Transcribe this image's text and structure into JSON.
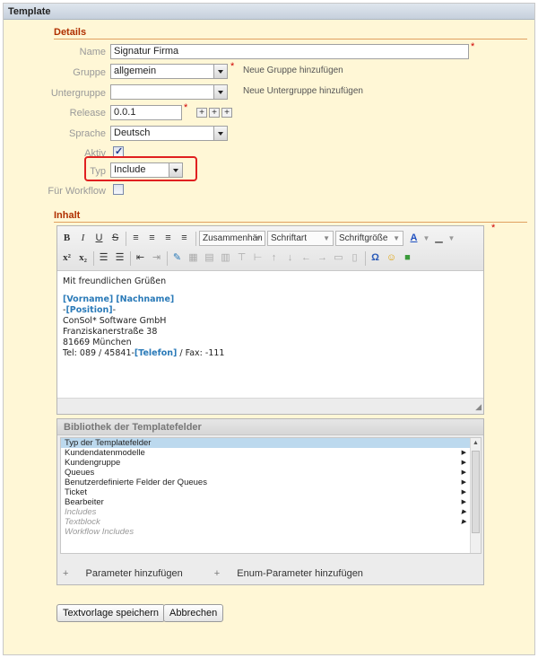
{
  "panel": {
    "title": "Template"
  },
  "details": {
    "section_title": "Details",
    "fields": {
      "name": {
        "label": "Name",
        "value": "Signatur Firma",
        "required": "*"
      },
      "gruppe": {
        "label": "Gruppe",
        "value": "allgemein",
        "required": "*",
        "hint": "Neue Gruppe hinzufügen"
      },
      "untergruppe": {
        "label": "Untergruppe",
        "value": "",
        "hint": "Neue Untergruppe hinzufügen"
      },
      "release": {
        "label": "Release",
        "value": "0.0.1",
        "required": "*"
      },
      "sprache": {
        "label": "Sprache",
        "value": "Deutsch"
      },
      "aktiv": {
        "label": "Aktiv",
        "checked": true
      },
      "typ": {
        "label": "Typ",
        "value": "Include"
      },
      "workflow": {
        "label": "Für Workflow",
        "checked": false
      }
    }
  },
  "inhalt": {
    "section_title": "Inhalt",
    "required": "*",
    "toolbar": {
      "bold": "B",
      "italic": "I",
      "underline": "U",
      "strike": "S",
      "style_combo": "Zusammenhän",
      "font_combo": "Schriftart",
      "size_combo": "Schriftgröße",
      "superscript": "x²",
      "subscript": "x₂",
      "omega": "Ω"
    },
    "content": {
      "greeting": "Mit freundlichen Grüßen",
      "vorname": "[Vorname]",
      "nachname": "[Nachname]",
      "pos_prefix": "-",
      "position": "[Position]",
      "pos_suffix": "-",
      "company": "ConSol* Software GmbH",
      "street": "Franziskanerstraße 38",
      "city": "81669 München",
      "tel_prefix": "Tel: 089 / 45841-",
      "telefon": "[Telefon]",
      "tel_suffix": " / Fax: -111"
    }
  },
  "library": {
    "title": "Bibliothek der Templatefelder",
    "items": [
      {
        "label": "Typ der Templatefelder",
        "selected": true,
        "muted": false,
        "arrow": ""
      },
      {
        "label": "Kundendatenmodelle",
        "selected": false,
        "muted": false,
        "arrow": "▶"
      },
      {
        "label": "Kundengruppe",
        "selected": false,
        "muted": false,
        "arrow": "▶"
      },
      {
        "label": "Queues",
        "selected": false,
        "muted": false,
        "arrow": "▶"
      },
      {
        "label": "Benutzerdefinierte Felder der Queues",
        "selected": false,
        "muted": false,
        "arrow": "▶"
      },
      {
        "label": "Ticket",
        "selected": false,
        "muted": false,
        "arrow": "▶"
      },
      {
        "label": "Bearbeiter",
        "selected": false,
        "muted": false,
        "arrow": "▶"
      },
      {
        "label": "Includes",
        "selected": false,
        "muted": true,
        "arrow": "▶"
      },
      {
        "label": "Textblock",
        "selected": false,
        "muted": true,
        "arrow": "▶"
      },
      {
        "label": "Workflow Includes",
        "selected": false,
        "muted": true,
        "arrow": ""
      }
    ],
    "add_param": "Parameter hinzufügen",
    "add_enum_param": "Enum-Parameter hinzufügen"
  },
  "buttons": {
    "save": "Textvorlage speichern",
    "cancel": "Abbrechen"
  },
  "colors": {
    "panel_bg": "#fff7d6",
    "section_title": "#b03000",
    "field_highlight": "#2a7ab8",
    "selection": "#bcd9ee",
    "focus_box": "#e02020"
  }
}
